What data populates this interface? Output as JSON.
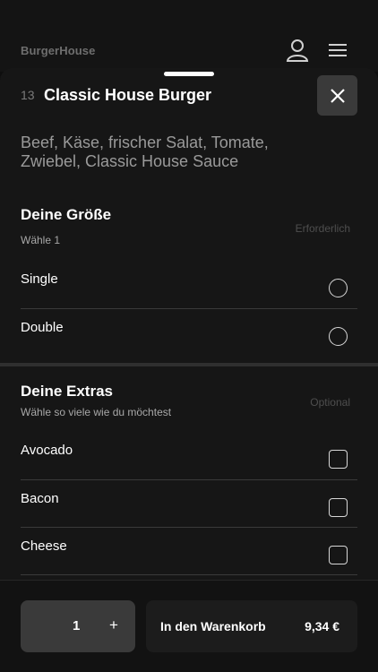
{
  "header": {
    "brand": "BurgerHouse",
    "icons": [
      "user-icon",
      "hamburger-menu-icon"
    ]
  },
  "sheet": {
    "item_number": "13",
    "title": "Classic House Burger",
    "close_icon": "close-icon",
    "description": "Beef, Käse, frischer Salat, Tomate, Zwiebel, Classic House Sauce"
  },
  "size_group": {
    "title": "Deine Größe",
    "subtitle": "Wähle 1",
    "tag": "Erforderlich",
    "options": [
      {
        "label": "Single",
        "selected": false
      },
      {
        "label": "Double",
        "selected": false
      }
    ]
  },
  "extras_group": {
    "title": "Deine Extras",
    "subtitle": "Wähle so viele wie du möchtest",
    "tag": "Optional",
    "options": [
      {
        "label": "Avocado",
        "checked": false
      },
      {
        "label": "Bacon",
        "checked": false
      },
      {
        "label": "Cheese",
        "checked": false
      }
    ]
  },
  "footer": {
    "quantity": "1",
    "increment": "+",
    "cart_label": "In den Warenkorb",
    "price": "9,34 €"
  },
  "colors": {
    "background": "#0e0e0e",
    "sheet": "#161616",
    "button": "#3a3a3a",
    "muted_text": "#9a9a9a"
  }
}
